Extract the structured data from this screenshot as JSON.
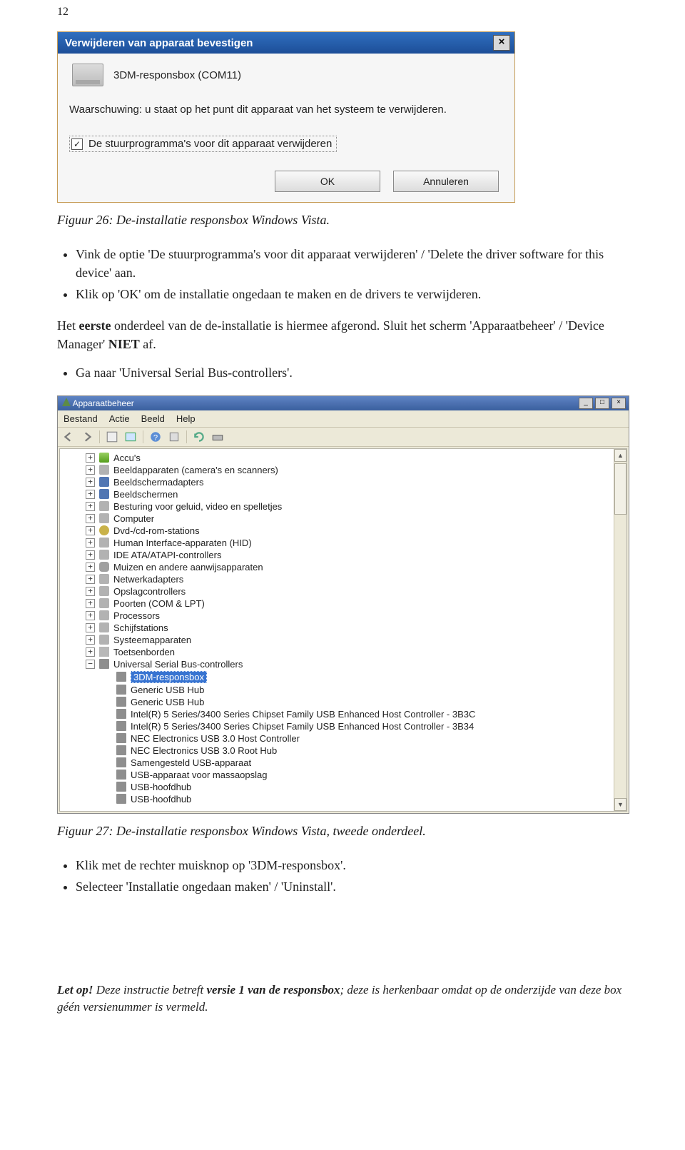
{
  "page_number": "12",
  "dialog": {
    "title": "Verwijderen van apparaat bevestigen",
    "close_symbol": "×",
    "device_label": "3DM-responsbox (COM11)",
    "warning_text": "Waarschuwing: u staat op het punt dit apparaat van het systeem te verwijderen.",
    "checkbox_label": "De stuurprogramma's voor dit apparaat verwijderen",
    "checkbox_checked": "✓",
    "ok_label": "OK",
    "cancel_label": "Annuleren"
  },
  "caption1": "Figuur 26: De-installatie responsbox Windows Vista.",
  "bullets1": [
    "Vink de optie 'De stuurprogramma's voor dit apparaat verwijderen' / 'Delete the driver software for this device' aan.",
    "Klik op 'OK' om de installatie ongedaan te maken en de drivers te verwijderen."
  ],
  "para_first": "Het ",
  "para_bold": "eerste",
  "para_rest1": " onderdeel van de de-installatie is hiermee afgerond. Sluit het scherm 'Apparaatbeheer' / 'Device Manager' ",
  "para_bold2": "NIET",
  "para_rest2": " af.",
  "bullets2": [
    "Ga naar 'Universal Serial Bus-controllers'."
  ],
  "dm": {
    "title": "Apparaatbeheer",
    "min": "_",
    "max": "□",
    "close": "×",
    "menu": [
      "Bestand",
      "Actie",
      "Beeld",
      "Help"
    ],
    "arrow_up": "▲",
    "arrow_down": "▼",
    "nodes": [
      {
        "depth": 2,
        "exp": "+",
        "icon": "ico-batt",
        "label": "Accu's"
      },
      {
        "depth": 2,
        "exp": "+",
        "icon": "ico-gen",
        "label": "Beeldapparaten (camera's en scanners)"
      },
      {
        "depth": 2,
        "exp": "+",
        "icon": "ico-mon",
        "label": "Beeldschermadapters"
      },
      {
        "depth": 2,
        "exp": "+",
        "icon": "ico-mon",
        "label": "Beeldschermen"
      },
      {
        "depth": 2,
        "exp": "+",
        "icon": "ico-gen",
        "label": "Besturing voor geluid, video en spelletjes"
      },
      {
        "depth": 2,
        "exp": "+",
        "icon": "ico-gen",
        "label": "Computer"
      },
      {
        "depth": 2,
        "exp": "+",
        "icon": "ico-dvd",
        "label": "Dvd-/cd-rom-stations"
      },
      {
        "depth": 2,
        "exp": "+",
        "icon": "ico-gen",
        "label": "Human Interface-apparaten (HID)"
      },
      {
        "depth": 2,
        "exp": "+",
        "icon": "ico-gen",
        "label": "IDE ATA/ATAPI-controllers"
      },
      {
        "depth": 2,
        "exp": "+",
        "icon": "ico-mouse",
        "label": "Muizen en andere aanwijsapparaten"
      },
      {
        "depth": 2,
        "exp": "+",
        "icon": "ico-gen",
        "label": "Netwerkadapters"
      },
      {
        "depth": 2,
        "exp": "+",
        "icon": "ico-gen",
        "label": "Opslagcontrollers"
      },
      {
        "depth": 2,
        "exp": "+",
        "icon": "ico-gen",
        "label": "Poorten (COM & LPT)"
      },
      {
        "depth": 2,
        "exp": "+",
        "icon": "ico-gen",
        "label": "Processors"
      },
      {
        "depth": 2,
        "exp": "+",
        "icon": "ico-gen",
        "label": "Schijfstations"
      },
      {
        "depth": 2,
        "exp": "+",
        "icon": "ico-gen",
        "label": "Systeemapparaten"
      },
      {
        "depth": 2,
        "exp": "+",
        "icon": "ico-kb",
        "label": "Toetsenborden"
      },
      {
        "depth": 2,
        "exp": "−",
        "icon": "ico-usb",
        "label": "Universal Serial Bus-controllers"
      },
      {
        "depth": 3,
        "exp": "",
        "icon": "ico-usb",
        "label": "3DM-responsbox",
        "selected": true
      },
      {
        "depth": 3,
        "exp": "",
        "icon": "ico-usb",
        "label": "Generic USB Hub"
      },
      {
        "depth": 3,
        "exp": "",
        "icon": "ico-usb",
        "label": "Generic USB Hub"
      },
      {
        "depth": 3,
        "exp": "",
        "icon": "ico-usb",
        "label": "Intel(R) 5 Series/3400 Series Chipset Family USB Enhanced Host Controller - 3B3C"
      },
      {
        "depth": 3,
        "exp": "",
        "icon": "ico-usb",
        "label": "Intel(R) 5 Series/3400 Series Chipset Family USB Enhanced Host Controller - 3B34"
      },
      {
        "depth": 3,
        "exp": "",
        "icon": "ico-usb",
        "label": "NEC Electronics USB 3.0 Host Controller"
      },
      {
        "depth": 3,
        "exp": "",
        "icon": "ico-usb",
        "label": "NEC Electronics USB 3.0 Root Hub"
      },
      {
        "depth": 3,
        "exp": "",
        "icon": "ico-usb",
        "label": "Samengesteld USB-apparaat"
      },
      {
        "depth": 3,
        "exp": "",
        "icon": "ico-usb",
        "label": "USB-apparaat voor massaopslag"
      },
      {
        "depth": 3,
        "exp": "",
        "icon": "ico-usb",
        "label": "USB-hoofdhub"
      },
      {
        "depth": 3,
        "exp": "",
        "icon": "ico-usb",
        "label": "USB-hoofdhub"
      }
    ]
  },
  "caption2": "Figuur 27: De-installatie responsbox Windows Vista, tweede onderdeel.",
  "bullets3": [
    "Klik met de rechter muisknop op '3DM-responsbox'.",
    "Selecteer 'Installatie ongedaan maken' / 'Uninstall'."
  ],
  "footer": {
    "lead": "Let op!",
    "mid1": " Deze instructie betreft ",
    "bold": "versie 1 van de responsbox",
    "mid2": "; deze is herkenbaar omdat op de onderzijde van deze box géén versienummer is vermeld."
  }
}
